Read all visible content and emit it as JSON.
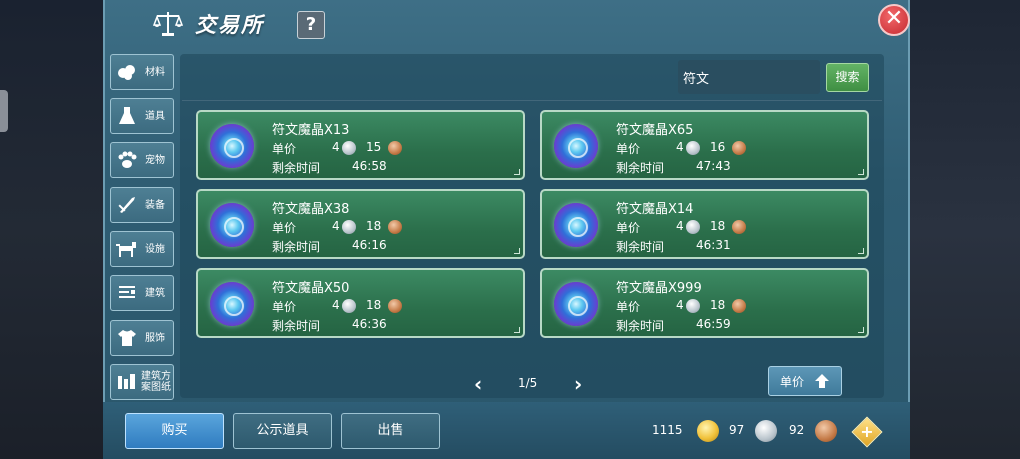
{
  "header": {
    "title": "交易所",
    "help_label": "?",
    "close_label": "✕"
  },
  "sidebar": {
    "items": [
      {
        "label": "材料",
        "icon": "materials-icon"
      },
      {
        "label": "道具",
        "icon": "flask-icon"
      },
      {
        "label": "宠物",
        "icon": "paw-icon"
      },
      {
        "label": "装备",
        "icon": "sword-icon"
      },
      {
        "label": "设施",
        "icon": "mount-icon"
      },
      {
        "label": "建筑",
        "icon": "building-icon"
      },
      {
        "label": "服饰",
        "icon": "clothing-icon"
      },
      {
        "label": "建筑方案图纸",
        "icon": "blueprint-icon"
      }
    ]
  },
  "search": {
    "value": "符文",
    "button_label": "搜索"
  },
  "listings": [
    {
      "name": "符文魔晶X13",
      "price_label": "单价",
      "silver": "4",
      "copper": "15",
      "time_label": "剩余时间",
      "time": "46:58"
    },
    {
      "name": "符文魔晶X65",
      "price_label": "单价",
      "silver": "4",
      "copper": "16",
      "time_label": "剩余时间",
      "time": "47:43"
    },
    {
      "name": "符文魔晶X38",
      "price_label": "单价",
      "silver": "4",
      "copper": "18",
      "time_label": "剩余时间",
      "time": "46:16"
    },
    {
      "name": "符文魔晶X14",
      "price_label": "单价",
      "silver": "4",
      "copper": "18",
      "time_label": "剩余时间",
      "time": "46:31"
    },
    {
      "name": "符文魔晶X50",
      "price_label": "单价",
      "silver": "4",
      "copper": "18",
      "time_label": "剩余时间",
      "time": "46:36"
    },
    {
      "name": "符文魔晶X999",
      "price_label": "单价",
      "silver": "4",
      "copper": "18",
      "time_label": "剩余时间",
      "time": "46:59"
    }
  ],
  "pager": {
    "prev": "‹",
    "text": "1/5",
    "next": "›"
  },
  "sort": {
    "label": "单价"
  },
  "tabs": {
    "buy": "购买",
    "public": "公示道具",
    "sell": "出售"
  },
  "wallet": {
    "gold": "1115",
    "silver": "97",
    "copper": "92",
    "add_label": "+"
  }
}
